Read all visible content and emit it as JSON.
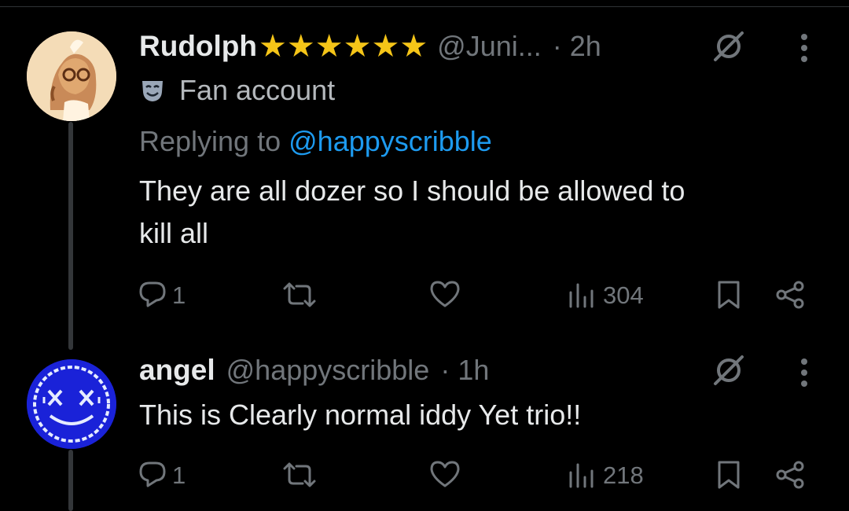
{
  "tweets": [
    {
      "name": "Rudolph",
      "stars": "★★★★★★",
      "handle": "@Juni...",
      "time": "· 2h",
      "badge": "Fan account",
      "replying_prefix": "Replying to",
      "replying_handle": "@happyscribble",
      "text_line1": "They are all dozer so I should be allowed to",
      "text_line2": "kill all",
      "replies": "1",
      "retweets": "",
      "likes": "",
      "views": "304"
    },
    {
      "name": "angel",
      "handle": "@happyscribble",
      "time": "· 1h",
      "text": "This is Clearly normal iddy Yet trio!!",
      "replies": "1",
      "retweets": "",
      "likes": "",
      "views": "218"
    }
  ],
  "colors": {
    "background": "#000000",
    "text": "#e7e9ea",
    "secondary": "#71767b",
    "mention": "#1d9bf0",
    "star": "#f5c518",
    "avatar2": "#1a22d8"
  },
  "icons": [
    "grok-icon",
    "more-icon",
    "reply-icon",
    "retweet-icon",
    "like-icon",
    "views-icon",
    "bookmark-icon",
    "share-icon",
    "mask-icon"
  ]
}
